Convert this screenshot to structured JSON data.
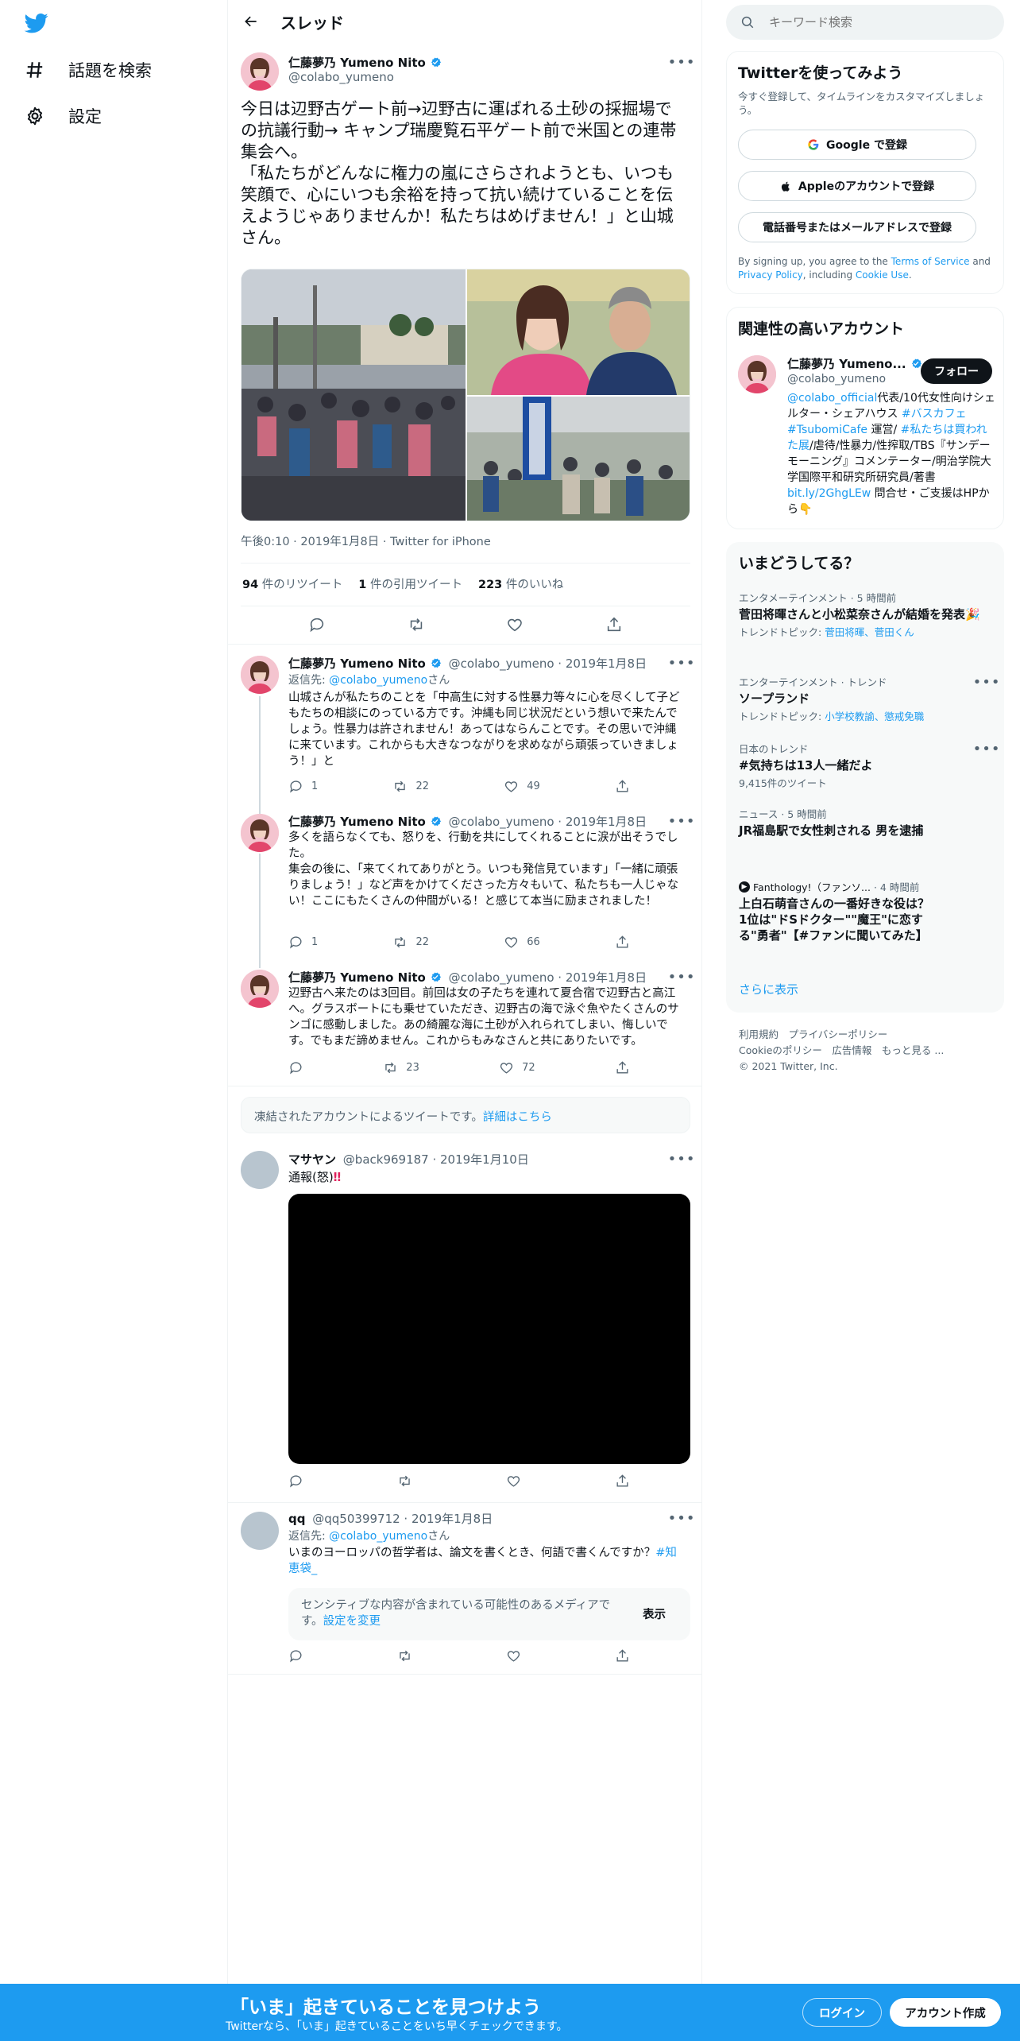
{
  "nav": {
    "explore_label": "話題を検索",
    "settings_label": "設定"
  },
  "header": {
    "title": "スレッド"
  },
  "main_tweet": {
    "name": "仁藤夢乃 Yumeno Nito",
    "handle": "@colabo_yumeno",
    "text": "今日は辺野古ゲート前→辺野古に運ばれる土砂の採掘場での抗議行動→ キャンプ瑞慶覧石平ゲート前で米国との連帯集会へ。\n「私たちがどんなに権力の嵐にさらされようとも、いつも笑顔で、心にいつも余裕を持って抗い続けていることを伝えようじゃありませんか！私たちはめげません！」と山城さん。",
    "time": "午後0:10 · 2019年1月8日 · Twitter for iPhone",
    "retweets": "94",
    "retweets_label": " 件のリツイート",
    "quotes": "1",
    "quotes_label": " 件の引用ツイート",
    "likes": "223",
    "likes_label": " 件のいいね"
  },
  "replies": [
    {
      "name": "仁藤夢乃 Yumeno Nito",
      "handle": "@colabo_yumeno · 2019年1月8日",
      "reply_prefix": "返信先: ",
      "reply_to": "@colabo_yumeno",
      "reply_suffix": "さん",
      "text": "山城さんが私たちのことを「中高生に対する性暴力等々に心を尽くして子どもたちの相談にのっている方です。沖縄も同じ状況だという想いで来たんでしょう。性暴力は許されません！あってはならんことです。その思いで沖縄に来ています。これからも大きなつながりを求めながら頑張っていきましょう！」と",
      "replies": "1",
      "retweets": "22",
      "likes": "49"
    },
    {
      "name": "仁藤夢乃 Yumeno Nito",
      "handle": "@colabo_yumeno · 2019年1月8日",
      "text": "多くを語らなくても、怒りを、行動を共にしてくれることに涙が出そうでした。\n集会の後に、「来てくれてありがとう。いつも発信見ています」「一緒に頑張りましょう！」など声をかけてくださった方々もいて、私たちも一人じゃない！ここにもたくさんの仲間がいる！と感じて本当に励まされました！",
      "replies": "1",
      "retweets": "22",
      "likes": "66"
    },
    {
      "name": "仁藤夢乃 Yumeno Nito",
      "handle": "@colabo_yumeno · 2019年1月8日",
      "text": "辺野古へ来たのは3回目。前回は女の子たちを連れて夏合宿で辺野古と高江へ。グラスボートにも乗せていただき、辺野古の海で泳ぐ魚やたくさんのサンゴに感動しました。あの綺麗な海に土砂が入れられてしまい、悔しいです。でもまだ諦めません。これからもみなさんと共にありたいです。",
      "retweets": "23",
      "likes": "72"
    }
  ],
  "frozen_notice": {
    "text": "凍結されたアカウントによるツイートです。",
    "link": "詳細はこちら"
  },
  "tweet_masayan": {
    "name": "マサヤン",
    "handle": "@back969187 · 2019年1月10日",
    "text": "通報(怒)"
  },
  "tweet_qq": {
    "name": "qq",
    "handle": "@qq50399712 · 2019年1月8日",
    "reply_prefix": "返信先: ",
    "reply_to": "@colabo_yumeno",
    "reply_suffix": "さん",
    "text": "いまのヨーロッパの哲学者は、論文を書くとき、何語で書くんですか？",
    "hashtag": "#知恵袋_",
    "sensitive_text": "センシティブな内容が含まれている可能性のあるメディアです。",
    "sensitive_link": "設定を変更",
    "show_label": "表示"
  },
  "search": {
    "placeholder": "キーワード検索"
  },
  "signup": {
    "title": "Twitterを使ってみよう",
    "subtitle": "今すぐ登録して、タイムラインをカスタマイズしましょう。",
    "google": "Google で登録",
    "apple": "Appleのアカウントで登録",
    "phone": "電話番号またはメールアドレスで登録",
    "legal_1": "By signing up, you agree to the ",
    "legal_tos": "Terms of Service",
    "legal_2": " and ",
    "legal_pp": "Privacy Policy",
    "legal_3": ", including ",
    "legal_cookie": "Cookie Use",
    "legal_4": "."
  },
  "related": {
    "title": "関連性の高いアカウント",
    "name": "仁藤夢乃 Yumeno...",
    "handle": "@colabo_yumeno",
    "follow": "フォロー",
    "bio_1": "@colabo_official",
    "bio_2": "代表/10代女性向けシェルター・シェアハウス ",
    "bio_3": "#バスカフェ",
    "bio_4": " ",
    "bio_5": "#TsubomiCafe",
    "bio_6": " 運営/ ",
    "bio_7": "#私たちは買われた展",
    "bio_8": "/虐待/性暴力/性搾取/TBS『サンデーモーニング』コメンテーター/明治学院大学国際平和研究所研究員/著書",
    "bio_9": "bit.ly/2GhgLEw",
    "bio_10": " 問合せ・ご支援はHPから👇"
  },
  "trends": {
    "title": "いまどうしてる？",
    "items": [
      {
        "meta": "エンタメーテインメント · 5 時間前",
        "title": "菅田将暉さんと小松菜奈さんが結婚を発表🎉",
        "sub_prefix": "トレンドトピック: ",
        "sub_links": "菅田将暉、菅田くん"
      },
      {
        "meta": "エンターテインメント · トレンド",
        "title": "ソープランド",
        "sub_prefix": "トレンドトピック: ",
        "sub_links": "小学校教諭、懲戒免職"
      },
      {
        "meta": "日本のトレンド",
        "title": "#気持ちは13人一緒だよ",
        "sub": "9,415件のツイート"
      },
      {
        "meta": "ニュース · 5 時間前",
        "title": "JR福島駅で女性刺される 男を逮捕"
      },
      {
        "meta_source": "Fanthology!（ファンソ...",
        "meta_time": " · 4 時間前",
        "title": "上白石萌音さんの一番好きな役は？ 1位は\"ドSドクター\"\"魔王\"に恋する\"勇者\"【#ファンに聞いてみた】"
      }
    ],
    "more": "さらに表示"
  },
  "footer": {
    "l1": "利用規約　プライバシーポリシー",
    "l2": "Cookieのポリシー　広告情報　もっと見る ...",
    "l3": "© 2021 Twitter, Inc."
  },
  "bottom": {
    "title": "「いま」起きていることを見つけよう",
    "subtitle": "Twitterなら、「いま」起きていることをいち早くチェックできます。",
    "login": "ログイン",
    "signup": "アカウント作成"
  },
  "colors": {
    "accent": "#1d9bf0",
    "text": "#0f1419",
    "muted": "#536471",
    "border": "#eff3f4"
  }
}
